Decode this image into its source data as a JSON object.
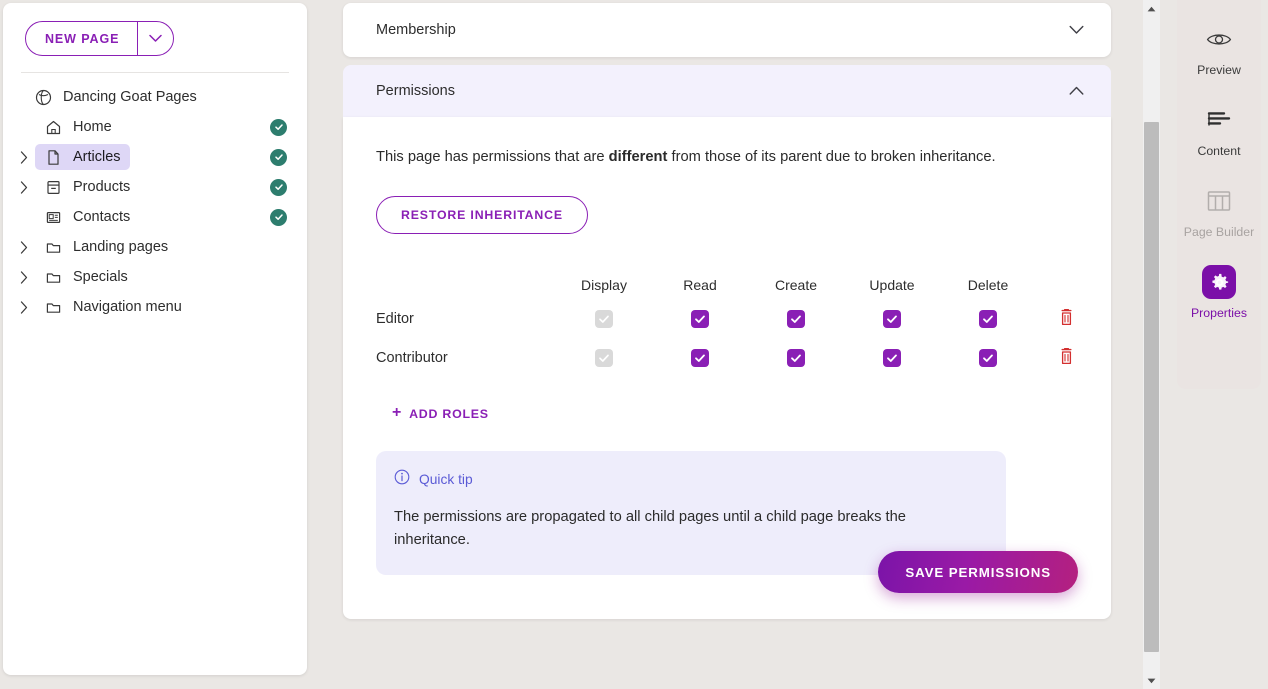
{
  "sidebar": {
    "new_page_button": "NEW PAGE",
    "tree_root": {
      "label": "Dancing Goat Pages",
      "icon": "globe-icon"
    },
    "items": [
      {
        "label": "Home",
        "icon": "home-icon",
        "expandable": false,
        "status": "published",
        "selected": false
      },
      {
        "label": "Articles",
        "icon": "page-icon",
        "expandable": true,
        "status": "published",
        "selected": true
      },
      {
        "label": "Products",
        "icon": "product-icon",
        "expandable": true,
        "status": "published",
        "selected": false
      },
      {
        "label": "Contacts",
        "icon": "contact-card-icon",
        "expandable": false,
        "status": "published",
        "selected": false
      },
      {
        "label": "Landing pages",
        "icon": "folder-icon",
        "expandable": true,
        "status": "",
        "selected": false
      },
      {
        "label": "Specials",
        "icon": "folder-icon",
        "expandable": true,
        "status": "",
        "selected": false
      },
      {
        "label": "Navigation menu",
        "icon": "folder-icon",
        "expandable": true,
        "status": "",
        "selected": false
      }
    ]
  },
  "accordion": {
    "membership": {
      "title": "Membership",
      "state": "collapsed",
      "chevron": "chevron-down-icon"
    },
    "permissions": {
      "title": "Permissions",
      "state": "expanded",
      "chevron": "chevron-up-icon"
    }
  },
  "permissions_panel": {
    "inheritance_notice_pre": "This page has permissions that are ",
    "inheritance_notice_bold": "different",
    "inheritance_notice_post": " from those of its parent due to broken inheritance.",
    "restore_button": "RESTORE INHERITANCE",
    "columns": [
      "Display",
      "Read",
      "Create",
      "Update",
      "Delete"
    ],
    "rows": [
      {
        "role": "Editor",
        "display": true,
        "display_disabled": true,
        "read": true,
        "create": true,
        "update": true,
        "delete": true,
        "delete_action": "delete-role"
      },
      {
        "role": "Contributor",
        "display": true,
        "display_disabled": true,
        "read": true,
        "create": true,
        "update": true,
        "delete": true,
        "delete_action": "delete-role"
      }
    ],
    "add_roles": "ADD ROLES",
    "add_roles_glyph": "+",
    "tip": {
      "icon": "info-circle-icon",
      "title": "Quick tip",
      "text": "The permissions are propagated to all child pages until a child page breaks the inheritance."
    },
    "save_button": "SAVE PERMISSIONS"
  },
  "right_rail": {
    "items": [
      {
        "label": "Preview",
        "icon": "eye-icon",
        "active": false,
        "disabled": false
      },
      {
        "label": "Content",
        "icon": "content-lines-icon",
        "active": false,
        "disabled": false
      },
      {
        "label": "Page Builder",
        "icon": "page-builder-columns-icon",
        "active": false,
        "disabled": true
      },
      {
        "label": "Properties",
        "icon": "gear-icon",
        "active": true,
        "disabled": false
      }
    ]
  },
  "colors": {
    "accent_purple": "#8a1fb5",
    "deep_purple": "#7b0fa8",
    "status_green": "#2d7d6e",
    "danger_red": "#d32f2f",
    "tip_indigo": "#5b5bd6",
    "selected_row": "#ded7f6"
  },
  "scrollbar": {
    "up_arrow": "▲",
    "down_arrow": "▼"
  }
}
